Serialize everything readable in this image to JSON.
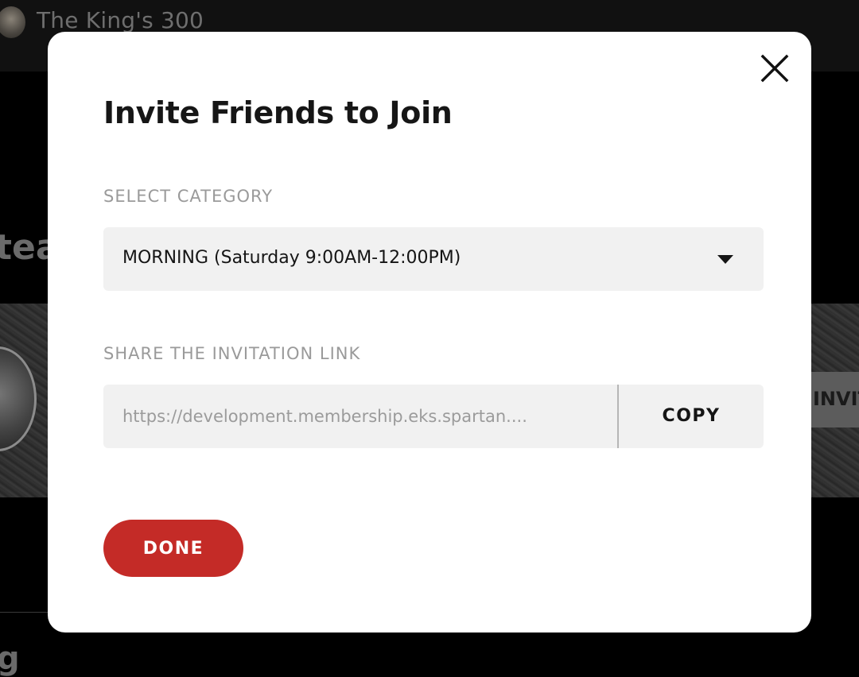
{
  "background": {
    "team_name": "The King's 300",
    "heading_fragment": "tea",
    "invite_button_fragment": "INVIT",
    "bottom_fragment": "g"
  },
  "modal": {
    "title": "Invite Friends to Join",
    "close_icon": "close-icon",
    "category": {
      "label": "SELECT CATEGORY",
      "selected_value": "MORNING (Saturday 9:00AM-12:00PM)",
      "caret_icon": "caret-down-icon"
    },
    "share": {
      "label": "SHARE THE INVITATION LINK",
      "link_value": "https://development.membership.eks.spartan....",
      "copy_label": "COPY"
    },
    "done_label": "DONE"
  },
  "colors": {
    "accent": "#c42b27",
    "field_background": "#f1f1f1",
    "label_gray": "#9a9a9a",
    "modal_background": "#ffffff"
  }
}
